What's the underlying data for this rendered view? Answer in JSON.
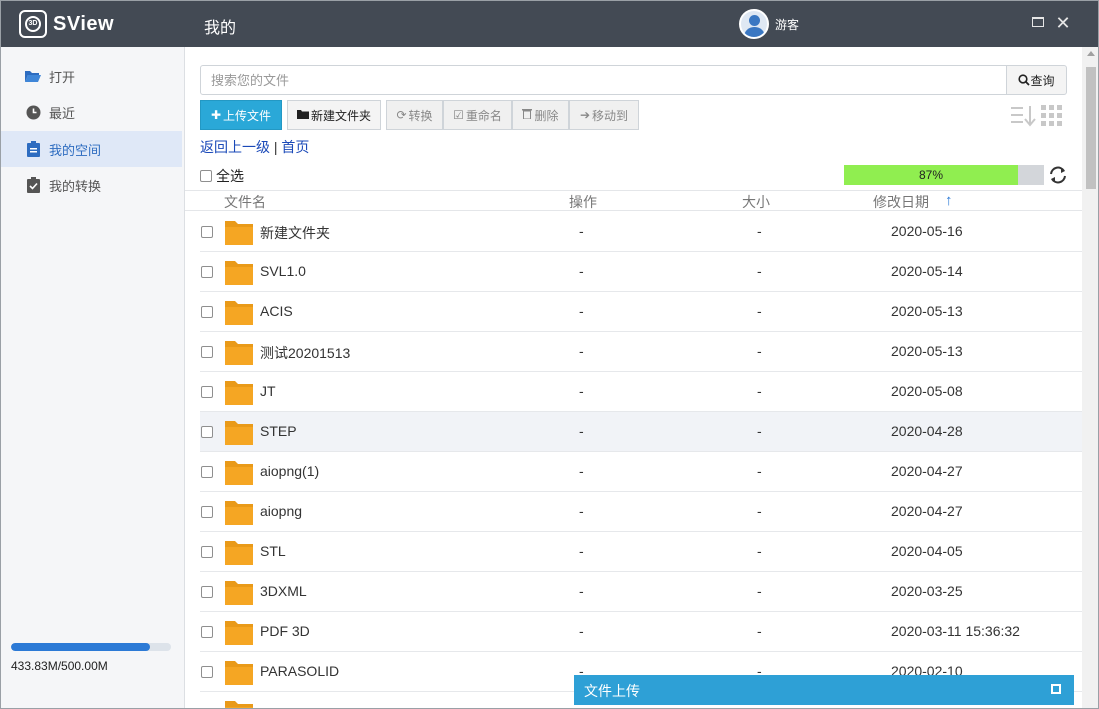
{
  "app": {
    "name": "SView",
    "logo_text": "3D"
  },
  "header": {
    "title": "我的",
    "user": "游客"
  },
  "sidebar": {
    "items": [
      {
        "label": "打开",
        "icon": "folder-open-icon"
      },
      {
        "label": "最近",
        "icon": "clock-icon"
      },
      {
        "label": "我的空间",
        "icon": "clipboard-icon"
      },
      {
        "label": "我的转换",
        "icon": "clipboard-check-icon"
      }
    ],
    "active_index": 2,
    "storage": {
      "text": "433.83M/500.00M",
      "used_fraction": 0.87
    }
  },
  "search": {
    "placeholder": "搜索您的文件",
    "button": "查询"
  },
  "toolbar": {
    "upload": "上传文件",
    "new_folder": "新建文件夹",
    "convert": "转换",
    "rename": "重命名",
    "delete": "删除",
    "move": "移动到"
  },
  "breadcrumb": {
    "up": "返回上一级",
    "separator": "|",
    "home": "首页"
  },
  "select_all": "全选",
  "progress": {
    "text": "87%",
    "fraction": 0.87
  },
  "table": {
    "headers": {
      "name": "文件名",
      "action": "操作",
      "size": "大小",
      "modified": "修改日期"
    },
    "rows": [
      {
        "name": "新建文件夹",
        "action": "-",
        "size": "-",
        "modified": "2020-05-16"
      },
      {
        "name": "SVL1.0",
        "action": "-",
        "size": "-",
        "modified": "2020-05-14"
      },
      {
        "name": "ACIS",
        "action": "-",
        "size": "-",
        "modified": "2020-05-13"
      },
      {
        "name": "测试20201513",
        "action": "-",
        "size": "-",
        "modified": "2020-05-13"
      },
      {
        "name": "JT",
        "action": "-",
        "size": "-",
        "modified": "2020-05-08"
      },
      {
        "name": "STEP",
        "action": "-",
        "size": "-",
        "modified": "2020-04-28"
      },
      {
        "name": "aiopng(1)",
        "action": "-",
        "size": "-",
        "modified": "2020-04-27"
      },
      {
        "name": "aiopng",
        "action": "-",
        "size": "-",
        "modified": "2020-04-27"
      },
      {
        "name": "STL",
        "action": "-",
        "size": "-",
        "modified": "2020-04-05"
      },
      {
        "name": "3DXML",
        "action": "-",
        "size": "-",
        "modified": "2020-03-25"
      },
      {
        "name": "PDF 3D",
        "action": "-",
        "size": "-",
        "modified": "2020-03-11 15:36:32"
      },
      {
        "name": "PARASOLID",
        "action": "-",
        "size": "-",
        "modified": "2020-02-10"
      }
    ],
    "hover_index": 5
  },
  "upload_panel": {
    "title": "文件上传"
  },
  "colors": {
    "titlebar": "#434a54",
    "accent": "#2aa8d8",
    "folder": "#f5a623",
    "progress": "#90ee50"
  }
}
